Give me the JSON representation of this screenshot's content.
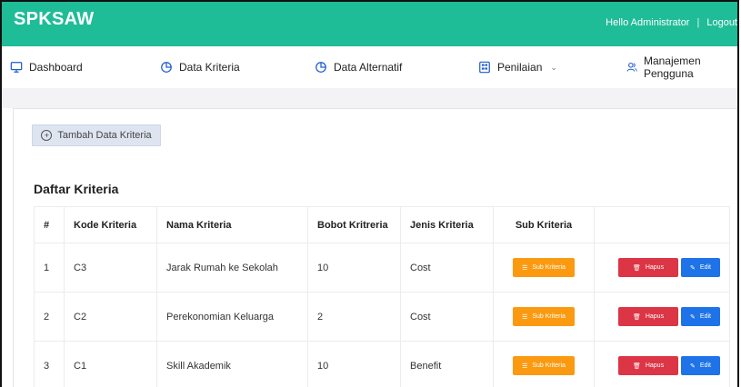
{
  "brand": "SPKSAW",
  "topbar": {
    "greeting": "Hello Administrator",
    "separator": "|",
    "logout": "Logout"
  },
  "nav": {
    "dashboard": "Dashboard",
    "data_kriteria": "Data Kriteria",
    "data_alternatif": "Data Alternatif",
    "penilaian": "Penilaian",
    "manajemen_pengguna": "Manajemen Pengguna"
  },
  "add_button": "Tambah Data Kriteria",
  "section_title": "Daftar Kriteria",
  "table": {
    "headers": [
      "#",
      "Kode Kriteria",
      "Nama Kriteria",
      "Bobot Kritreria",
      "Jenis Kriteria",
      "Sub Kriteria"
    ],
    "rows": [
      {
        "no": "1",
        "kode": "C3",
        "nama": "Jarak Rumah ke Sekolah",
        "bobot": "10",
        "jenis": "Cost"
      },
      {
        "no": "2",
        "kode": "C2",
        "nama": "Perekonomian Keluarga",
        "bobot": "2",
        "jenis": "Cost"
      },
      {
        "no": "3",
        "kode": "C1",
        "nama": "Skill Akademik",
        "bobot": "10",
        "jenis": "Benefit"
      }
    ],
    "sub_button": "Sub Kriteria",
    "delete_button": "Hapus",
    "edit_button": "Edit"
  },
  "colors": {
    "topbar": "#1fbc98",
    "orange_button": "#fb9a10",
    "red_button": "#dc3545",
    "blue_button": "#1e73e8",
    "add_button_bg": "#dfe4f1"
  }
}
